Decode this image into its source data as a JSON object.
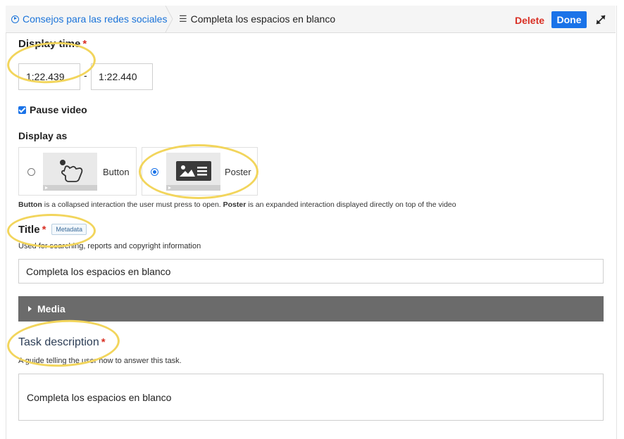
{
  "header": {
    "breadcrumb_parent": "Consejos para las redes sociales",
    "breadcrumb_current": "Completa los espacios en blanco",
    "delete_label": "Delete",
    "done_label": "Done"
  },
  "display_time": {
    "label": "Display time",
    "required": "*",
    "start": "1:22.439",
    "separator": "-",
    "end": "1:22.440"
  },
  "pause_video": {
    "label": "Pause video",
    "checked": true
  },
  "display_as": {
    "label": "Display as",
    "options": [
      {
        "label": "Button",
        "selected": false
      },
      {
        "label": "Poster",
        "selected": true
      }
    ],
    "help_button_term": "Button",
    "help_button_text": " is a collapsed interaction the user must press to open. ",
    "help_poster_term": "Poster",
    "help_poster_text": " is an expanded interaction displayed directly on top of the video"
  },
  "title_field": {
    "label": "Title",
    "required": "*",
    "badge": "Metadata",
    "description": "Used for searching, reports and copyright information",
    "value": "Completa los espacios en blanco"
  },
  "media": {
    "label": "Media"
  },
  "task_description": {
    "label": "Task description",
    "required": "*",
    "description": "A guide telling the user how to answer this task.",
    "value": "Completa los espacios en blanco"
  },
  "colors": {
    "accent": "#1a73e8",
    "delete": "#d93025",
    "highlight_circle": "#f2d55c",
    "media_bar": "#6b6b6b"
  }
}
